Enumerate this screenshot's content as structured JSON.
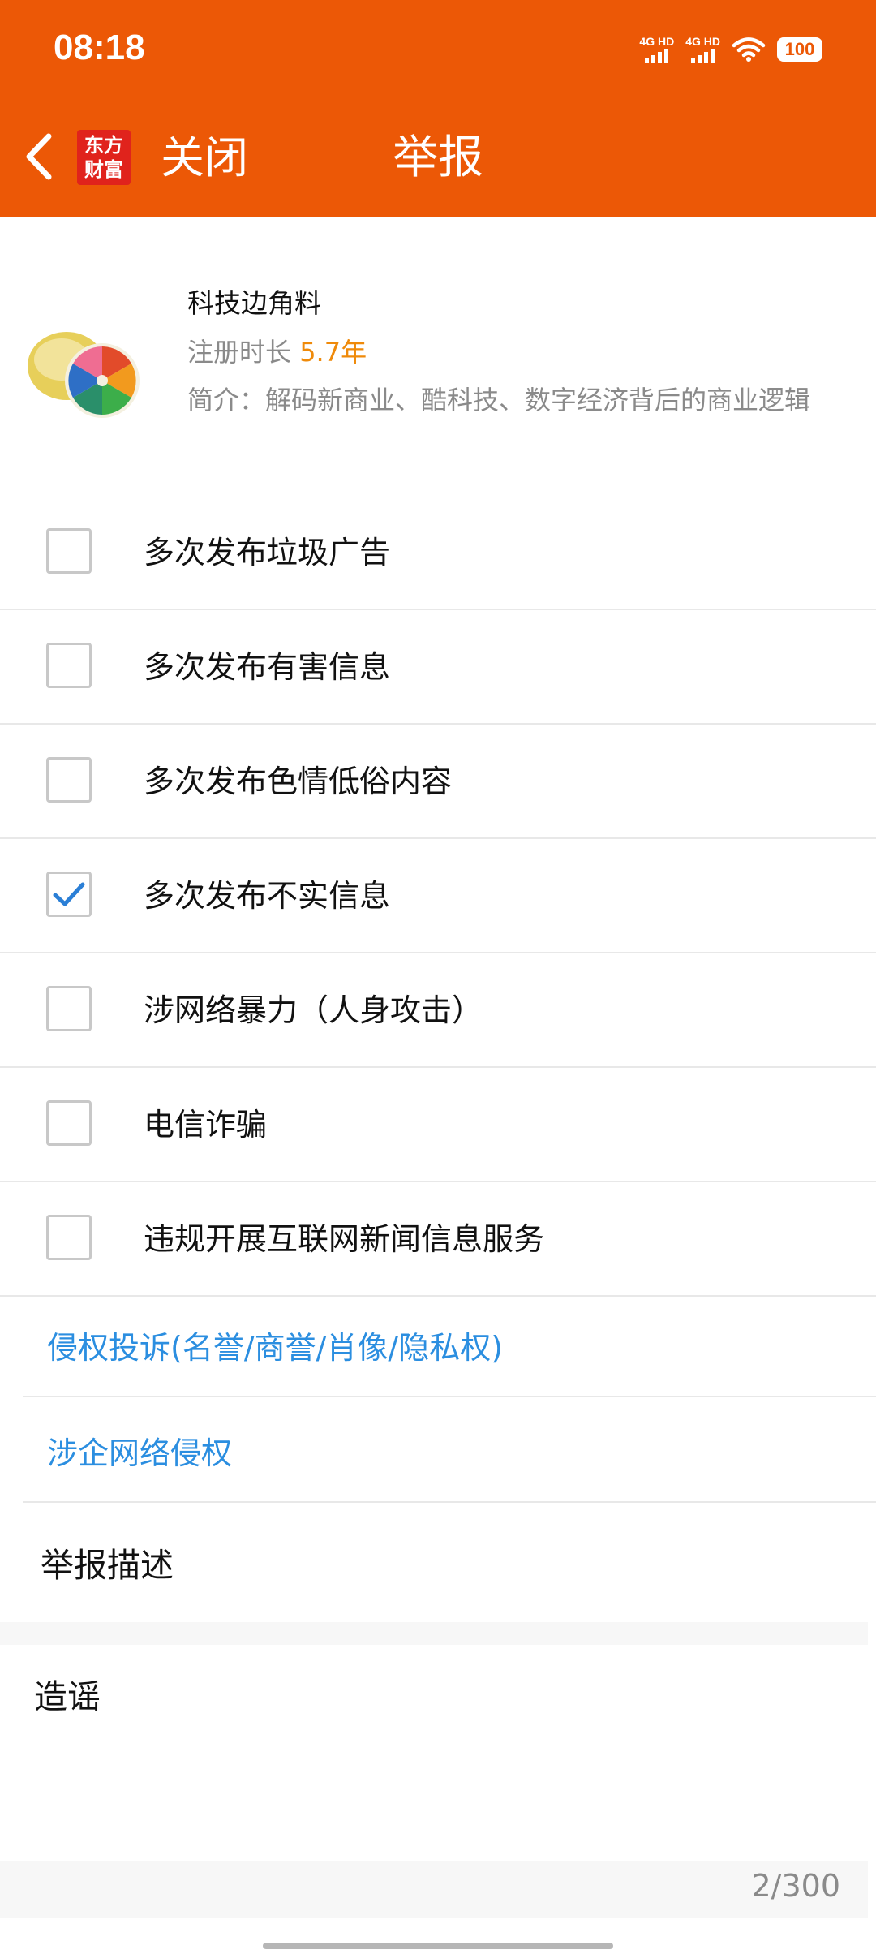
{
  "status_bar": {
    "time": "08:18",
    "signal1_label": "4G HD",
    "signal2_label": "4G HD",
    "battery": "100"
  },
  "nav": {
    "brand_line1": "东方",
    "brand_line2": "财富",
    "close_label": "关闭",
    "title": "举报"
  },
  "profile": {
    "name": "科技边角料",
    "reg_label": "注册时长 ",
    "reg_years": "5.7年",
    "bio": "简介：解码新商业、酷科技、数字经济背后的商业逻辑"
  },
  "options": [
    {
      "label": "多次发布垃圾广告",
      "checked": false
    },
    {
      "label": "多次发布有害信息",
      "checked": false
    },
    {
      "label": "多次发布色情低俗内容",
      "checked": false
    },
    {
      "label": "多次发布不实信息",
      "checked": true
    },
    {
      "label": "涉网络暴力（人身攻击）",
      "checked": false
    },
    {
      "label": "电信诈骗",
      "checked": false
    },
    {
      "label": "违规开展互联网新闻信息服务",
      "checked": false
    }
  ],
  "links": {
    "infringement": "侵权投诉(名誉/商誉/肖像/隐私权)",
    "enterprise": "涉企网络侵权"
  },
  "description": {
    "title": "举报描述",
    "text": "造谣",
    "counter": "2/300"
  },
  "colors": {
    "header": "#ec5806",
    "link": "#2b8ee0",
    "accent_years": "#ef8a0a",
    "check": "#2b7fd6"
  },
  "icons": {
    "back": "chevron-left-icon",
    "wifi": "wifi-icon",
    "checkmark": "checkmark-icon"
  }
}
